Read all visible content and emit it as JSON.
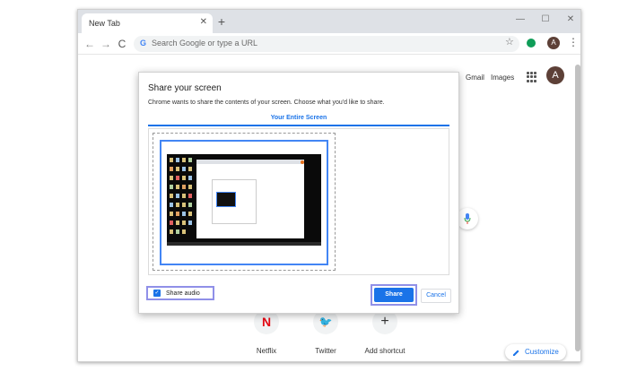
{
  "browser": {
    "tab_title": "New Tab",
    "tab_close": "✕",
    "new_tab": "+",
    "window_controls": {
      "minimize": "—",
      "maximize": "☐",
      "close": "✕"
    },
    "nav": {
      "back": "←",
      "forward": "→",
      "reload": "C"
    },
    "omnibox": {
      "logo": "G",
      "placeholder": "Search Google or type a URL"
    },
    "star": "☆",
    "avatar_letter": "A",
    "menu": "⋮"
  },
  "page": {
    "links": {
      "gmail": "Gmail",
      "images": "Images"
    },
    "avatar_letter": "A",
    "shortcuts": [
      {
        "icon": "N",
        "label": "Netflix",
        "color": "#e50914"
      },
      {
        "icon": "🐦",
        "label": "Twitter",
        "color": "#1da1f2"
      },
      {
        "icon": "+",
        "label": "Add shortcut",
        "color": "#333333"
      }
    ],
    "customize_label": "Customize"
  },
  "dialog": {
    "title": "Share your screen",
    "description": "Chrome wants to share the contents of your screen. Choose what you'd like to share.",
    "tab_label": "Your Entire Screen",
    "share_audio_label": "Share audio",
    "share_audio_checked": "✓",
    "share_button": "Share",
    "cancel_button": "Cancel"
  },
  "colors": {
    "accent": "#1a73e8",
    "highlight_border": "#9090e8",
    "tab_strip": "#dee1e6"
  }
}
